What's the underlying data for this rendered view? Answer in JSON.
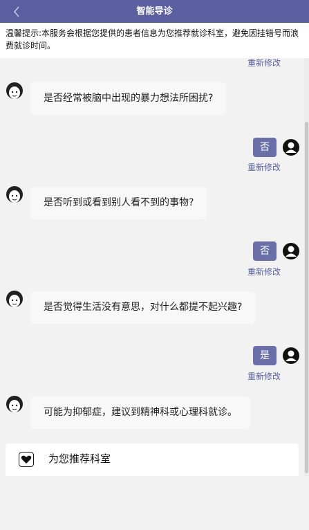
{
  "header": {
    "title": "智能导诊",
    "back_icon": "chevron-left-icon"
  },
  "tip": {
    "text": "温馨提示:本服务会根据您提供的患者信息为您推荐就诊科室，避免因挂错号而浪费就诊时间。"
  },
  "chat": {
    "edit_label": "重新修改",
    "messages": [
      {
        "question": "是否经常被脑中出现的暴力想法所困扰?",
        "answer": "否"
      },
      {
        "question": "是否听到或看到别人看不到的事物?",
        "answer": "否"
      },
      {
        "question": "是否觉得生活没有意思，对什么都提不起兴趣?",
        "answer": "是"
      }
    ],
    "conclusion": "可能为抑郁症，建议到精神科或心理科就诊。"
  },
  "recommend": {
    "label": "为您推荐科室",
    "icon": "heart-icon"
  },
  "colors": {
    "header": "#5b5f9f",
    "answer_bubble": "#6a6fa8",
    "edit_link": "#5a5f9a"
  }
}
